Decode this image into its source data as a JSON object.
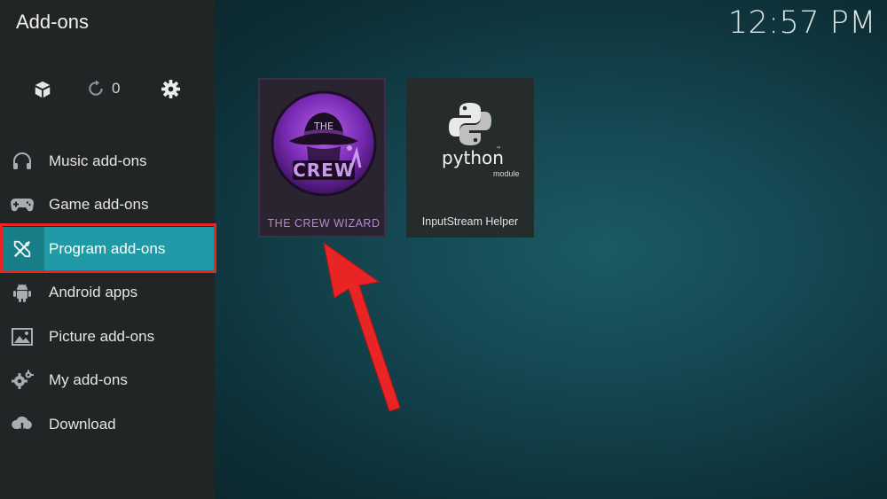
{
  "app": {
    "title": "Add-ons",
    "clock": "12:57 PM"
  },
  "toolbar": {
    "refresh_count": "0",
    "icons": [
      "box-icon",
      "refresh-icon",
      "gear-icon"
    ]
  },
  "sidebar": {
    "items": [
      {
        "label": "Music add-ons",
        "icon": "headphones-icon",
        "active": false
      },
      {
        "label": "Game add-ons",
        "icon": "gamepad-icon",
        "active": false
      },
      {
        "label": "Program add-ons",
        "icon": "tools-icon",
        "active": true
      },
      {
        "label": "Android apps",
        "icon": "android-icon",
        "active": false
      },
      {
        "label": "Picture add-ons",
        "icon": "picture-icon",
        "active": false
      },
      {
        "label": "My add-ons",
        "icon": "gears-icon",
        "active": false
      },
      {
        "label": "Download",
        "icon": "cloud-download-icon",
        "active": false
      }
    ]
  },
  "tiles": [
    {
      "caption": "THE CREW WIZARD",
      "logo_text": [
        "THE",
        "CREW"
      ],
      "selected": true
    },
    {
      "caption": "InputStream Helper",
      "logo_text": [
        "python",
        "™",
        "module"
      ],
      "selected": false
    }
  ],
  "colors": {
    "active_item": "#1f9aa6",
    "highlight_border": "#e82424",
    "arrow": "#e82424",
    "crew_caption": "#b48ad2"
  }
}
